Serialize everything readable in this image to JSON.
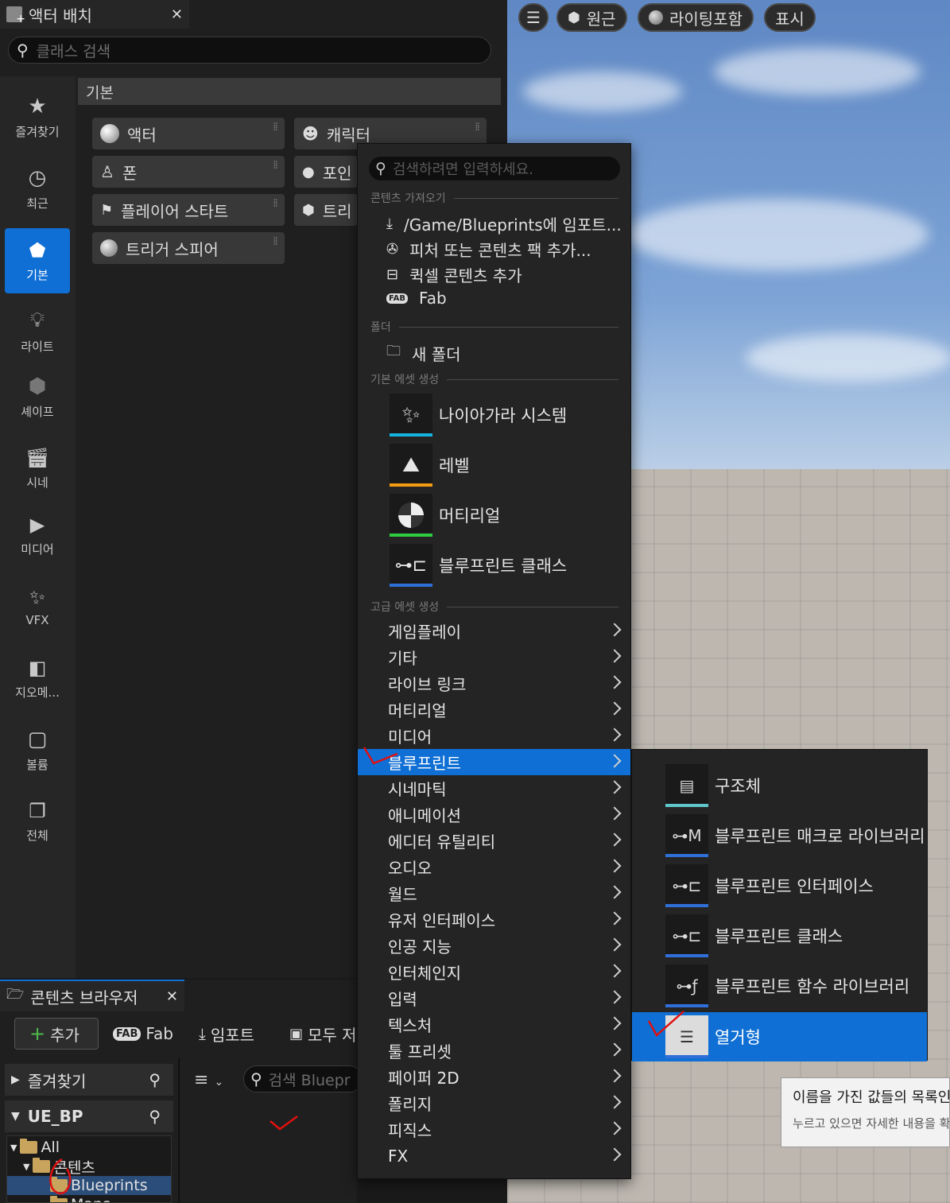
{
  "place_actors": {
    "tab_title": "액터 배치",
    "search_placeholder": "클래스 검색",
    "category_header": "기본",
    "nav": [
      {
        "label": "즐겨찾기",
        "icon": "star-icon"
      },
      {
        "label": "최근",
        "icon": "clock-icon"
      },
      {
        "label": "기본",
        "icon": "shapes-icon",
        "active": true
      },
      {
        "label": "라이트",
        "icon": "bulb-icon"
      },
      {
        "label": "셰이프",
        "icon": "cube-icon"
      },
      {
        "label": "시네",
        "icon": "clapper-icon"
      },
      {
        "label": "미디어",
        "icon": "media-icon"
      },
      {
        "label": "VFX",
        "icon": "sparkles-icon"
      },
      {
        "label": "지오메...",
        "icon": "geometry-icon"
      },
      {
        "label": "볼륨",
        "icon": "volume-icon"
      },
      {
        "label": "전체",
        "icon": "stack-icon"
      }
    ],
    "actors": [
      "액터",
      "캐릭터",
      "폰",
      "포인",
      "플레이어 스타트",
      "트리",
      "트리거 스피어"
    ]
  },
  "viewport": {
    "buttons": [
      "원근",
      "라이팅포함",
      "표시"
    ]
  },
  "context_menu": {
    "search_placeholder": "검색하려면 입력하세요.",
    "section_import": "콘텐츠 가져오기",
    "import_items": [
      "/Game/Blueprints에 임포트...",
      "피처 또는 콘텐츠 팩 추가...",
      "퀵셀 콘텐츠 추가",
      "Fab"
    ],
    "section_folder": "폴더",
    "new_folder": "새 폴더",
    "section_basic": "기본 에셋 생성",
    "basic_assets": [
      {
        "label": "나이아가라 시스템",
        "color": "#16b4e0"
      },
      {
        "label": "레벨",
        "color": "#f39c12"
      },
      {
        "label": "머티리얼",
        "color": "#2ecc40"
      },
      {
        "label": "블루프린트 클래스",
        "color": "#2f6fd8"
      }
    ],
    "section_advanced": "고급 에셋 생성",
    "advanced": [
      "게임플레이",
      "기타",
      "라이브 링크",
      "머티리얼",
      "미디어",
      "블루프린트",
      "시네마틱",
      "애니메이션",
      "에디터 유틸리티",
      "오디오",
      "월드",
      "유저 인터페이스",
      "인공 지능",
      "인터체인지",
      "입력",
      "텍스처",
      "툴 프리셋",
      "페이퍼 2D",
      "폴리지",
      "피직스",
      "FX"
    ],
    "selected_index": 5
  },
  "submenu": {
    "items": [
      {
        "label": "구조체",
        "color": "#5fc7cc"
      },
      {
        "label": "블루프린트 매크로 라이브러리",
        "color": "#2f6fd8"
      },
      {
        "label": "블루프린트 인터페이스",
        "color": "#2f6fd8"
      },
      {
        "label": "블루프린트 클래스",
        "color": "#2f6fd8"
      },
      {
        "label": "블루프린트 함수 라이브러리",
        "color": "#2f6fd8"
      },
      {
        "label": "열거형",
        "color": "#2f6fd8"
      }
    ],
    "selected_index": 5
  },
  "tooltip": {
    "line1": "이름을 가진 값들의 목록인",
    "line2": "누르고 있으면 자세한 내용을 확"
  },
  "content_browser": {
    "tab_title": "콘텐츠 브라우저",
    "add_label": "추가",
    "fab_label": "Fab",
    "import_label": "임포트",
    "save_all_label": "모두 저",
    "search_placeholder": "검색 Bluepr",
    "favorites_label": "즐겨찾기",
    "project_label": "UE_BP",
    "tree": [
      "All",
      "콘텐츠",
      "Blueprints",
      "Maps"
    ]
  }
}
